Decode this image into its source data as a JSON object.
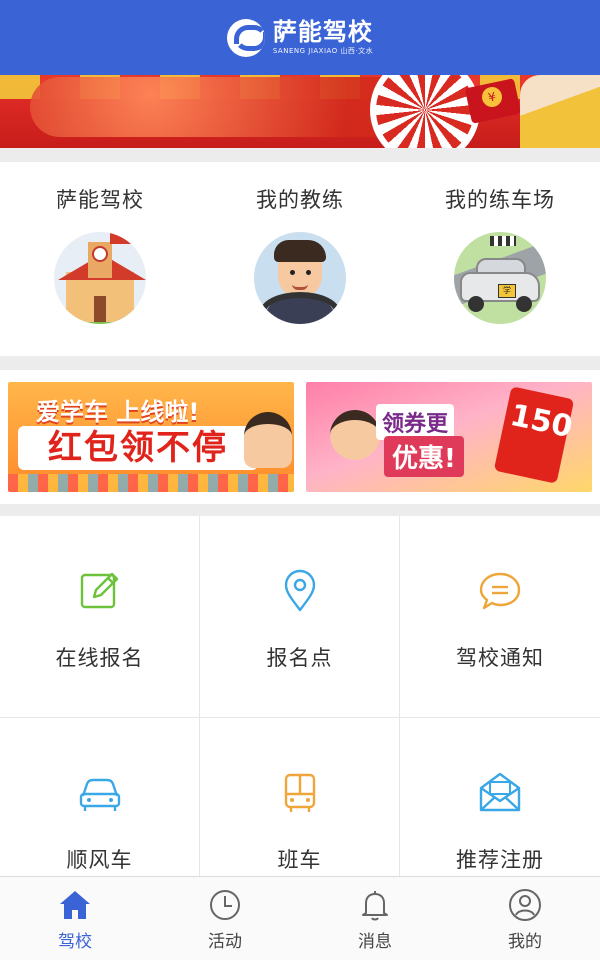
{
  "header": {
    "logo_cn": "萨能驾校",
    "logo_en": "SANENG JIAXIAO 山西·文水"
  },
  "quick_links": [
    {
      "label": "萨能驾校",
      "icon": "school-illustration"
    },
    {
      "label": "我的教练",
      "icon": "coach-illustration"
    },
    {
      "label": "我的练车场",
      "icon": "practice-car-illustration"
    }
  ],
  "promos": [
    {
      "line1": "爱学车 上线啦!",
      "line2": "红包领不停"
    },
    {
      "line1": "领券更",
      "line2": "优惠!",
      "badge": "150"
    }
  ],
  "services": [
    {
      "label": "在线报名",
      "icon": "edit-icon",
      "color": "#6cc23a"
    },
    {
      "label": "报名点",
      "icon": "location-pin-icon",
      "color": "#3aa7e6"
    },
    {
      "label": "驾校通知",
      "icon": "chat-bubble-icon",
      "color": "#f0a53a"
    },
    {
      "label": "顺风车",
      "icon": "car-icon",
      "color": "#3aa7e6"
    },
    {
      "label": "班车",
      "icon": "bus-icon",
      "color": "#f0a53a"
    },
    {
      "label": "推荐注册",
      "icon": "envelope-icon",
      "color": "#3aa7e6"
    }
  ],
  "tabs": [
    {
      "label": "驾校",
      "icon": "home-icon",
      "active": true
    },
    {
      "label": "活动",
      "icon": "clock-icon",
      "active": false
    },
    {
      "label": "消息",
      "icon": "bell-icon",
      "active": false
    },
    {
      "label": "我的",
      "icon": "user-icon",
      "active": false
    }
  ],
  "colors": {
    "brand": "#3a63d6",
    "tab_inactive": "#444444"
  }
}
